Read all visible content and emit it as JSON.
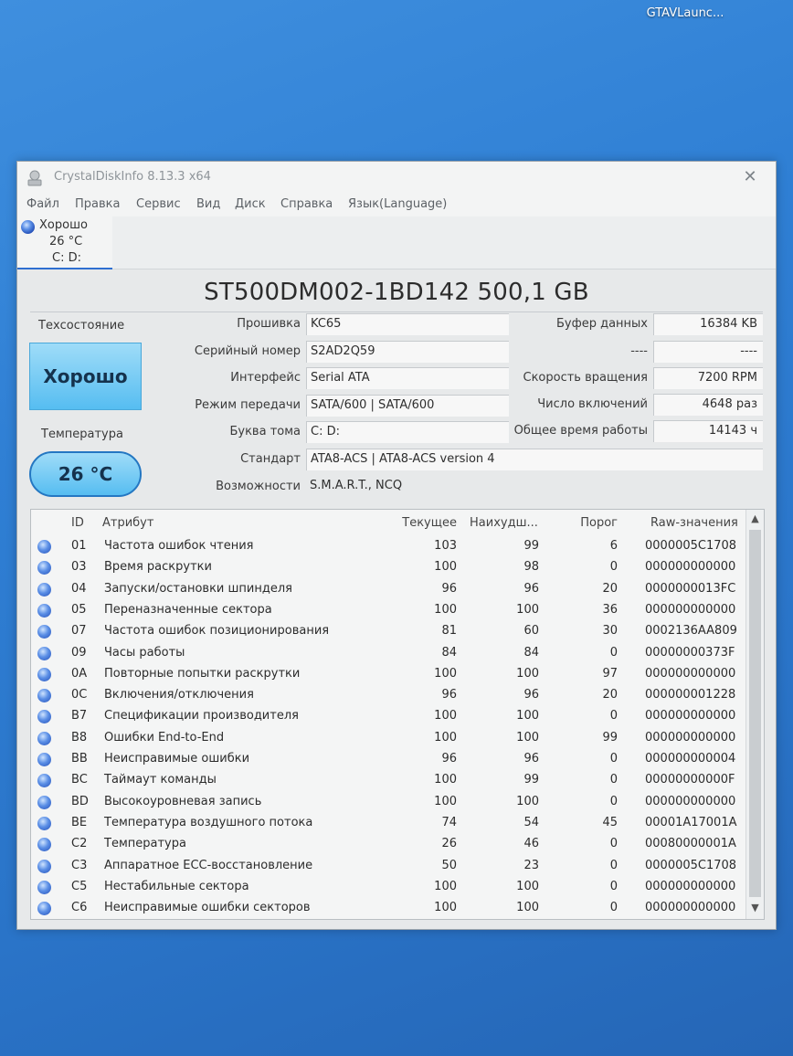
{
  "desktop": {
    "icon_label": "GTAVLaunc..."
  },
  "window": {
    "title": "CrystalDiskInfo 8.13.3 x64",
    "close_symbol": "✕",
    "menu": [
      "Файл",
      "Правка",
      "Сервис",
      "Вид",
      "Диск",
      "Справка",
      "Язык(Language)"
    ]
  },
  "disk_tab": {
    "status": "Хорошо",
    "temp": "26 °C",
    "letters": "C: D:"
  },
  "model": "ST500DM002-1BD142 500,1 GB",
  "health": {
    "label": "Техсостояние",
    "value": "Хорошо",
    "color": "#56bdf1"
  },
  "temperature": {
    "label": "Температура",
    "value": "26 °C"
  },
  "info_left": [
    {
      "label": "Прошивка",
      "value": "KC65"
    },
    {
      "label": "Серийный номер",
      "value": "S2AD2Q59"
    },
    {
      "label": "Интерфейс",
      "value": "Serial ATA"
    },
    {
      "label": "Режим передачи",
      "value": "SATA/600 | SATA/600"
    },
    {
      "label": "Буква тома",
      "value": "C: D:"
    }
  ],
  "info_wide": [
    {
      "label": "Стандарт",
      "value": "ATA8-ACS | ATA8-ACS version 4"
    },
    {
      "label": "Возможности",
      "value": "S.M.A.R.T., NCQ"
    }
  ],
  "info_right": [
    {
      "label": "Буфер данных",
      "value": "16384 KB"
    },
    {
      "label": "----",
      "value": "----"
    },
    {
      "label": "Скорость вращения",
      "value": "7200 RPM"
    },
    {
      "label": "Число включений",
      "value": "4648 раз"
    },
    {
      "label": "Общее время работы",
      "value": "14143 ч"
    }
  ],
  "smart": {
    "headers": {
      "id": "ID",
      "attr": "Атрибут",
      "cur": "Текущее",
      "worst": "Наихудш...",
      "thr": "Порог",
      "raw": "Raw-значения"
    },
    "rows": [
      {
        "id": "01",
        "attr": "Частота ошибок чтения",
        "cur": "103",
        "worst": "99",
        "thr": "6",
        "raw": "0000005C1708"
      },
      {
        "id": "03",
        "attr": "Время раскрутки",
        "cur": "100",
        "worst": "98",
        "thr": "0",
        "raw": "000000000000"
      },
      {
        "id": "04",
        "attr": "Запуски/остановки шпинделя",
        "cur": "96",
        "worst": "96",
        "thr": "20",
        "raw": "0000000013FC"
      },
      {
        "id": "05",
        "attr": "Переназначенные сектора",
        "cur": "100",
        "worst": "100",
        "thr": "36",
        "raw": "000000000000"
      },
      {
        "id": "07",
        "attr": "Частота ошибок позиционирования",
        "cur": "81",
        "worst": "60",
        "thr": "30",
        "raw": "0002136AA809"
      },
      {
        "id": "09",
        "attr": "Часы работы",
        "cur": "84",
        "worst": "84",
        "thr": "0",
        "raw": "00000000373F"
      },
      {
        "id": "0A",
        "attr": "Повторные попытки раскрутки",
        "cur": "100",
        "worst": "100",
        "thr": "97",
        "raw": "000000000000"
      },
      {
        "id": "0C",
        "attr": "Включения/отключения",
        "cur": "96",
        "worst": "96",
        "thr": "20",
        "raw": "000000001228"
      },
      {
        "id": "B7",
        "attr": "Спецификации производителя",
        "cur": "100",
        "worst": "100",
        "thr": "0",
        "raw": "000000000000"
      },
      {
        "id": "B8",
        "attr": "Ошибки End-to-End",
        "cur": "100",
        "worst": "100",
        "thr": "99",
        "raw": "000000000000"
      },
      {
        "id": "BB",
        "attr": "Неисправимые ошибки",
        "cur": "96",
        "worst": "96",
        "thr": "0",
        "raw": "000000000004"
      },
      {
        "id": "BC",
        "attr": "Таймаут команды",
        "cur": "100",
        "worst": "99",
        "thr": "0",
        "raw": "00000000000F"
      },
      {
        "id": "BD",
        "attr": "Высокоуровневая запись",
        "cur": "100",
        "worst": "100",
        "thr": "0",
        "raw": "000000000000"
      },
      {
        "id": "BE",
        "attr": "Температура воздушного потока",
        "cur": "74",
        "worst": "54",
        "thr": "45",
        "raw": "00001A17001A"
      },
      {
        "id": "C2",
        "attr": "Температура",
        "cur": "26",
        "worst": "46",
        "thr": "0",
        "raw": "00080000001A"
      },
      {
        "id": "C3",
        "attr": "Аппаратное ECC-восстановление",
        "cur": "50",
        "worst": "23",
        "thr": "0",
        "raw": "0000005C1708"
      },
      {
        "id": "C5",
        "attr": "Нестабильные сектора",
        "cur": "100",
        "worst": "100",
        "thr": "0",
        "raw": "000000000000"
      },
      {
        "id": "C6",
        "attr": "Неисправимые ошибки секторов",
        "cur": "100",
        "worst": "100",
        "thr": "0",
        "raw": "000000000000"
      }
    ]
  }
}
